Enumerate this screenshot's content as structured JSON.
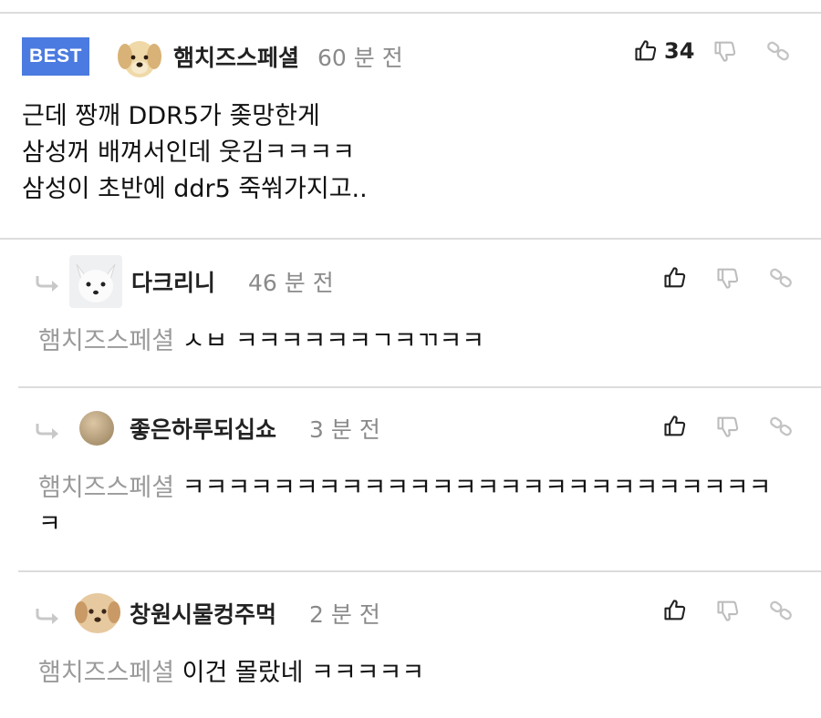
{
  "best_badge": "BEST",
  "comments": [
    {
      "nick": "햄치즈스페셜",
      "time": "60 분 전",
      "likes": "34",
      "lines": [
        "근데 짱깨 DDR5가 좆망한게",
        "삼성꺼 배껴서인데 웃김ㅋㅋㅋㅋ",
        "삼성이 초반에 ddr5 죽쒀가지고.."
      ]
    }
  ],
  "replies": [
    {
      "nick": "다크리니",
      "time": "46 분 전",
      "mention": "햄치즈스페셜",
      "text": "ㅅㅂ ㅋㅋㅋㅋㅋㅋㄱㅋㄲㅋㅋ"
    },
    {
      "nick": "좋은하루되십쇼",
      "time": "3 분 전",
      "mention": "햄치즈스페셜",
      "text": "ㅋㅋㅋㅋㅋㅋㅋㅋㅋㅋㅋㅋㅋㅋㅋㅋㅋㅋㅋㅋㅋㅋㅋㅋㅋㅋ",
      "text2": "ㅋ"
    },
    {
      "nick": "창원시물컹주먹",
      "time": "2 분 전",
      "mention": "햄치즈스페셜",
      "text": "이건 몰랐네 ㅋㅋㅋㅋㅋ"
    }
  ],
  "icons": {
    "like": "thumbs-up-icon",
    "dislike": "thumbs-down-icon",
    "link": "link-icon",
    "reply": "reply-arrow-icon"
  },
  "colors": {
    "best_badge": "#4b7be0",
    "mention": "#9a9a9a",
    "time": "#8a8a8a",
    "divider": "#dcdcdc"
  }
}
